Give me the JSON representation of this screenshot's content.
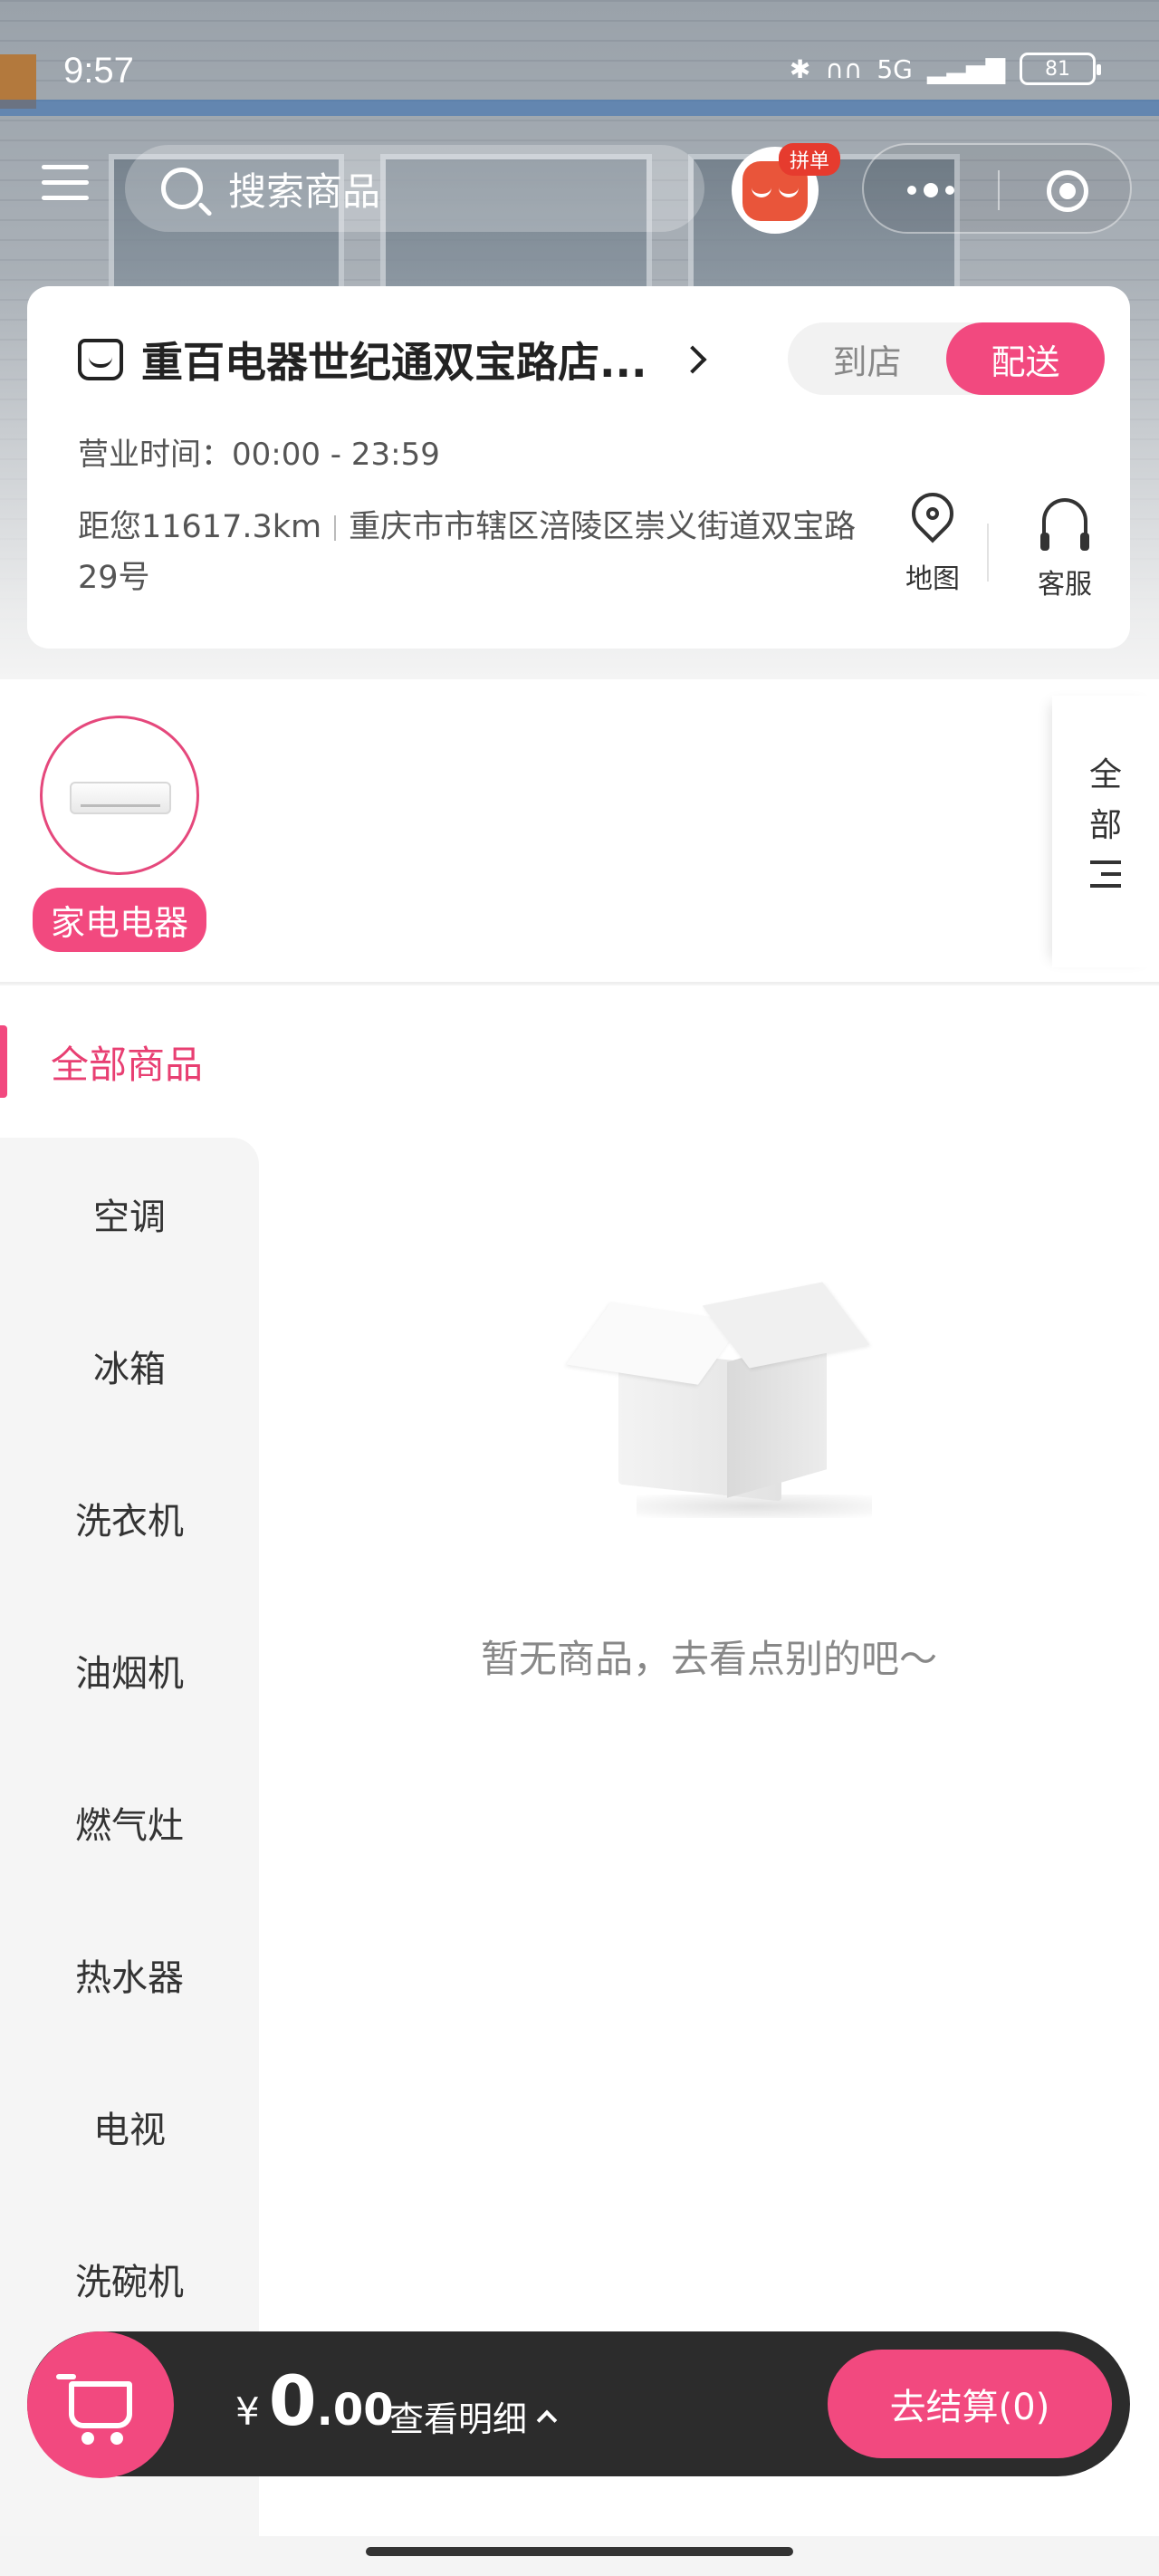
{
  "status_bar": {
    "time": "9:57",
    "network": "5G",
    "battery": "81"
  },
  "top_nav": {
    "search_placeholder": "搜索商品",
    "group_badge": "拼单"
  },
  "store": {
    "name": "重百电器世纪通双宝路店...",
    "mode_pickup": "到店",
    "mode_delivery": "配送",
    "hours": "营业时间：00:00 - 23:59",
    "distance": "距您11617.3km",
    "address": "重庆市市辖区涪陵区崇义街道双宝路29号",
    "map_label": "地图",
    "service_label": "客服"
  },
  "category_strip": {
    "active_label": "家电电器",
    "all_toggle_chars": [
      "全",
      "部"
    ]
  },
  "main": {
    "all_products_label": "全部商品",
    "sidebar_items": [
      "空调",
      "冰箱",
      "洗衣机",
      "油烟机",
      "燃气灶",
      "热水器",
      "电视",
      "洗碗机"
    ],
    "empty_text": "暂无商品，去看点别的吧～"
  },
  "cart": {
    "currency": "¥",
    "amount_int": "0",
    "amount_dec": ".00",
    "detail_label": "查看明细",
    "checkout_label": "去结算(0)"
  },
  "colors": {
    "accent": "#f2497f",
    "cart_bar": "#2c2c2c"
  }
}
